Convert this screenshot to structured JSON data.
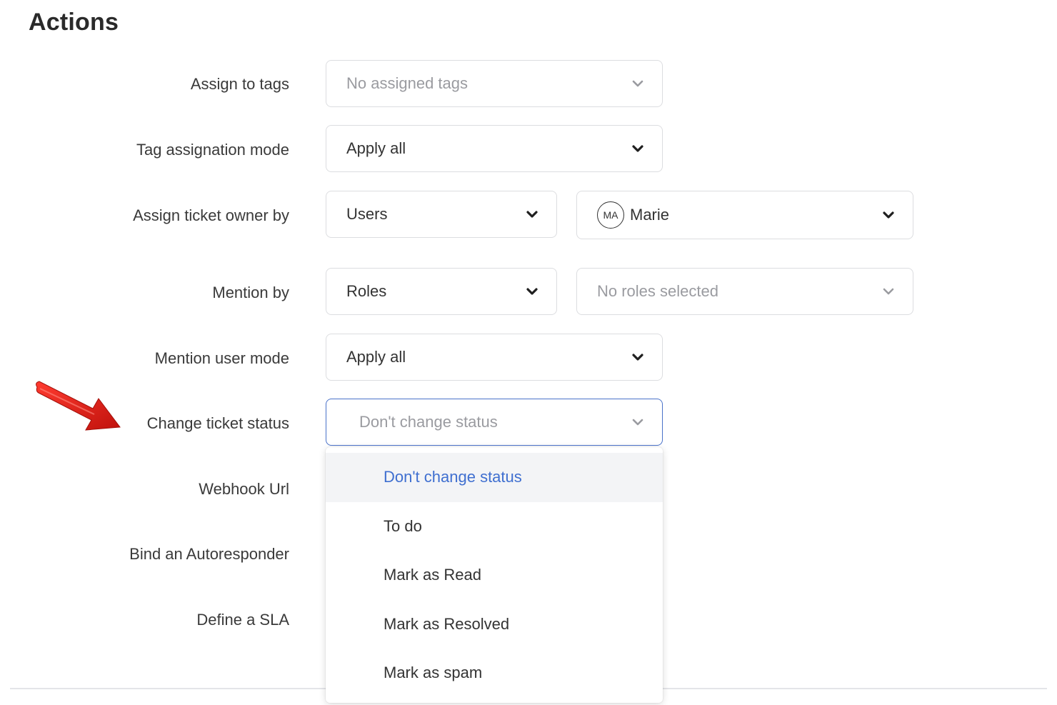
{
  "section_title": "Actions",
  "fields": {
    "assign_to_tags": {
      "label": "Assign to tags",
      "value": "No assigned tags"
    },
    "tag_assignation_mode": {
      "label": "Tag assignation mode",
      "value": "Apply all"
    },
    "assign_ticket_owner_by": {
      "label": "Assign ticket owner by",
      "type_value": "Users",
      "owner_initials": "MA",
      "owner_value": "Marie"
    },
    "mention_by": {
      "label": "Mention by",
      "type_value": "Roles",
      "roles_value": "No roles selected"
    },
    "mention_user_mode": {
      "label": "Mention user mode",
      "value": "Apply all"
    },
    "change_ticket_status": {
      "label": "Change ticket status",
      "value": "Don't change status"
    },
    "webhook_url": {
      "label": "Webhook Url"
    },
    "bind_autoresponder": {
      "label": "Bind an Autoresponder"
    },
    "define_sla": {
      "label": "Define a SLA"
    }
  },
  "status_dropdown": {
    "options": [
      "Don't change status",
      "To do",
      "Mark as Read",
      "Mark as Resolved",
      "Mark as spam"
    ],
    "selected": "Don't change status"
  },
  "annotation": {
    "arrow_color": "#e32119"
  },
  "colors": {
    "accent": "#3f6fd0",
    "focus_border": "#4a72c9"
  }
}
